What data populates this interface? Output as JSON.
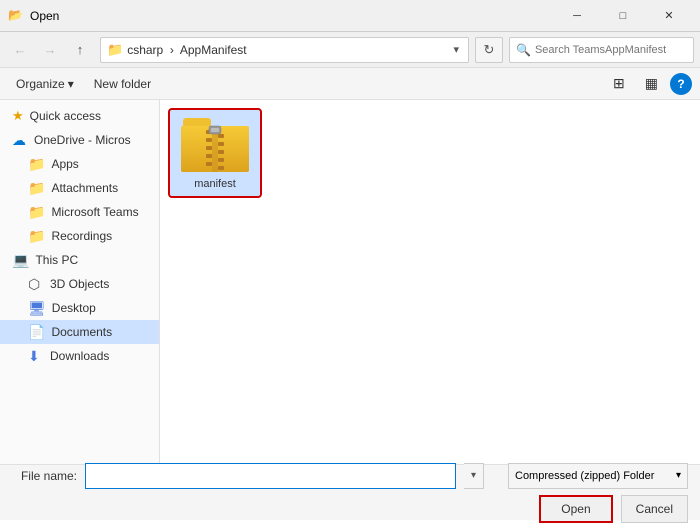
{
  "window": {
    "title": "Open",
    "icon": "📂"
  },
  "navbar": {
    "back_tooltip": "Back",
    "forward_tooltip": "Forward",
    "up_tooltip": "Up",
    "path_icon": "📁",
    "path_parts": [
      "csharp",
      "AppManifest"
    ],
    "refresh_tooltip": "Refresh",
    "search_placeholder": "Search TeamsAppManifest"
  },
  "toolbar": {
    "organize_label": "Organize",
    "new_folder_label": "New folder",
    "view_icon": "⊞",
    "layout_icon": "▦",
    "help_icon": "?"
  },
  "sidebar": {
    "quick_access_label": "Quick access",
    "onedrive_label": "OneDrive - Micros",
    "items_onedrive": [
      {
        "name": "Apps",
        "icon": "folder"
      },
      {
        "name": "Attachments",
        "icon": "folder"
      },
      {
        "name": "Microsoft Teams",
        "icon": "folder"
      },
      {
        "name": "Recordings",
        "icon": "folder"
      }
    ],
    "thispc_label": "This PC",
    "items_pc": [
      {
        "name": "3D Objects",
        "icon": "3d"
      },
      {
        "name": "Desktop",
        "icon": "desktop"
      },
      {
        "name": "Documents",
        "icon": "docs",
        "selected": true
      },
      {
        "name": "Downloads",
        "icon": "downloads"
      }
    ]
  },
  "files": [
    {
      "name": "manifest",
      "type": "zip-folder"
    }
  ],
  "bottom": {
    "filename_label": "File name:",
    "filename_value": "",
    "filetype_label": "Compressed (zipped) Folder",
    "open_label": "Open",
    "cancel_label": "Cancel"
  }
}
